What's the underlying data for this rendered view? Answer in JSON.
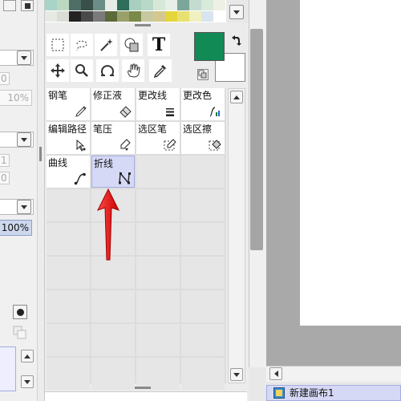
{
  "left_panel": {
    "num_values": [
      "0",
      "1",
      "0"
    ],
    "opacity_disabled": "10%",
    "opacity_active": "100%"
  },
  "palette": {
    "row1": [
      "#a8d4c8",
      "#bcd8c0",
      "#4e6e66",
      "#3a4f4a",
      "#6a8e86",
      "#e8ece6",
      "#2e6e5a",
      "#a8cfc0",
      "#b8d8c8",
      "#d8e8d8",
      "#e8eee8",
      "#7ca69a",
      "#c4dcd0",
      "#d8ead8",
      "#eef0e6"
    ],
    "row2": [
      "#e6eae2",
      "#dadcd6",
      "#222222",
      "#4a4a4a",
      "#7a7a7a",
      "#5a6a3a",
      "#9aa06a",
      "#7a8a4a",
      "#c8c8a0",
      "#d4c890",
      "#e4d63a",
      "#e8e070",
      "#f0f0c0",
      "#d8e4f0",
      "#ffffff"
    ]
  },
  "colors": {
    "foreground": "#118a55",
    "background": "#ffffff",
    "selection": "#d6d9f6",
    "arrow": "#e21b1b"
  },
  "toolbar_icons": [
    "rect-select-icon",
    "lasso-icon",
    "magic-wand-icon",
    "shape-select-icon",
    "text-tool-icon",
    "move-icon",
    "zoom-icon",
    "rotate-icon",
    "hand-icon",
    "eyedropper-icon"
  ],
  "text_tool_glyph": "T",
  "tools": [
    {
      "label": "钢笔",
      "icon": "pen-nib-icon"
    },
    {
      "label": "修正液",
      "icon": "eraser-icon"
    },
    {
      "label": "更改线",
      "icon": "line-weight-icon"
    },
    {
      "label": "更改色",
      "icon": "color-change-icon"
    },
    {
      "label": "编辑路径",
      "icon": "path-edit-icon"
    },
    {
      "label": "笔压",
      "icon": "pressure-icon"
    },
    {
      "label": "选区笔",
      "icon": "select-pen-icon"
    },
    {
      "label": "选区擦",
      "icon": "select-eraser-icon"
    },
    {
      "label": "曲线",
      "icon": "curve-icon"
    },
    {
      "label": "折线",
      "icon": "polyline-icon"
    }
  ],
  "document_tab": {
    "title": "新建画布1"
  }
}
